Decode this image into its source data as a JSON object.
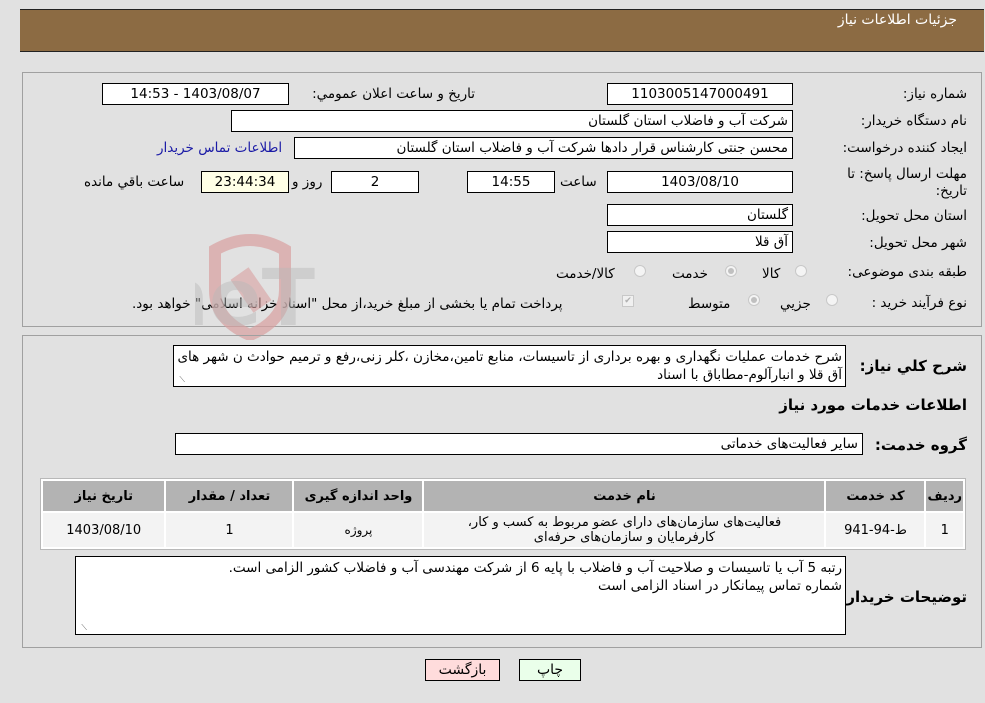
{
  "header": {
    "title": "جزئیات اطلاعات نیاز"
  },
  "form": {
    "need_number": {
      "label": "شماره نیاز:",
      "value": "1103005147000491"
    },
    "announce_datetime": {
      "label": "تاريخ و ساعت اعلان عمومي:",
      "value": "1403/08/07 - 14:53"
    },
    "buyer_org": {
      "label": "نام دستگاه خريدار:",
      "value": "شرکت آب و فاضلاب استان گلستان"
    },
    "creator": {
      "label": "ايجاد کننده درخواست:",
      "value": "محسن جنتی کارشناس قرار دادها شرکت آب و فاضلاب استان گلستان",
      "contact_link": "اطلاعات تماس خريدار"
    },
    "deadline": {
      "label_line1": "مهلت ارسال پاسخ: تا",
      "label_line2": "تاريخ:",
      "date": "1403/08/10",
      "time_label": "ساعت",
      "time": "14:55",
      "days": "2",
      "days_label": "روز و",
      "remaining": "23:44:34",
      "remaining_label": "ساعت باقي مانده"
    },
    "province": {
      "label": "استان محل تحويل:",
      "value": "گلستان"
    },
    "city": {
      "label": "شهر محل تحويل:",
      "value": "آق قلا"
    },
    "category": {
      "label": "طبقه بندی موضوعی:",
      "options": [
        {
          "label": "کالا",
          "checked": false
        },
        {
          "label": "خدمت",
          "checked": true
        },
        {
          "label": "کالا/خدمت",
          "checked": false
        }
      ]
    },
    "purchase_type": {
      "label": "نوع فرآیند خرید :",
      "options": [
        {
          "label": "جزيي",
          "checked": false
        },
        {
          "label": "متوسط",
          "checked": true
        }
      ],
      "treasury_checkbox": {
        "label": "پرداخت تمام يا بخشی از مبلغ خريد،از محل \"اسناد خزانه اسلامی\" خواهد بود.",
        "checked": true
      }
    }
  },
  "summary": {
    "label": "شرح کلي نياز:",
    "text": "شرح خدمات عملیات نگهداری و بهره برداری از تاسیسات، منابع تامین،مخازن ،کلر زنی،رفع و ترمیم حوادث ن شهر های آق قلا و انبارآلوم-مطاباق با اسناد"
  },
  "services_section": {
    "title": "اطلاعات خدمات مورد نياز",
    "group_label": "گروه خدمت:",
    "group_value": "ساير فعاليت‌های خدماتی"
  },
  "table": {
    "headers": [
      "رديف",
      "کد خدمت",
      "نام خدمت",
      "واحد اندازه گيری",
      "تعداد / مقدار",
      "تاريخ نياز"
    ],
    "rows": [
      [
        "1",
        "ط-94-941",
        "فعاليت‌های سازمان‌های دارای عضو مربوط به کسب و کار، کارفرمايان و سازمان‌های حرفه‌ای",
        "پروژه",
        "1",
        "1403/08/10"
      ]
    ]
  },
  "buyer_notes": {
    "label": "توضيحات خريدار:",
    "line1": "رتبه 5 آب یا تاسیسات و صلاحیت آب و فاضلاب با پایه 6 از شرکت مهندسی آب و فاضلاب کشور الزامی است.",
    "line2": "شماره تماس پیمانکار در اسناد الزامی است"
  },
  "buttons": {
    "print": "چاپ",
    "back": "بازگشت"
  },
  "watermark": {
    "text": "AriaTender.neT"
  },
  "colors": {
    "header_bg": "#8c6b43",
    "page_bg": "#e1e1e1",
    "print_bg": "#eaffea",
    "back_bg": "#ffdcdc",
    "link": "#1a1aa6"
  }
}
